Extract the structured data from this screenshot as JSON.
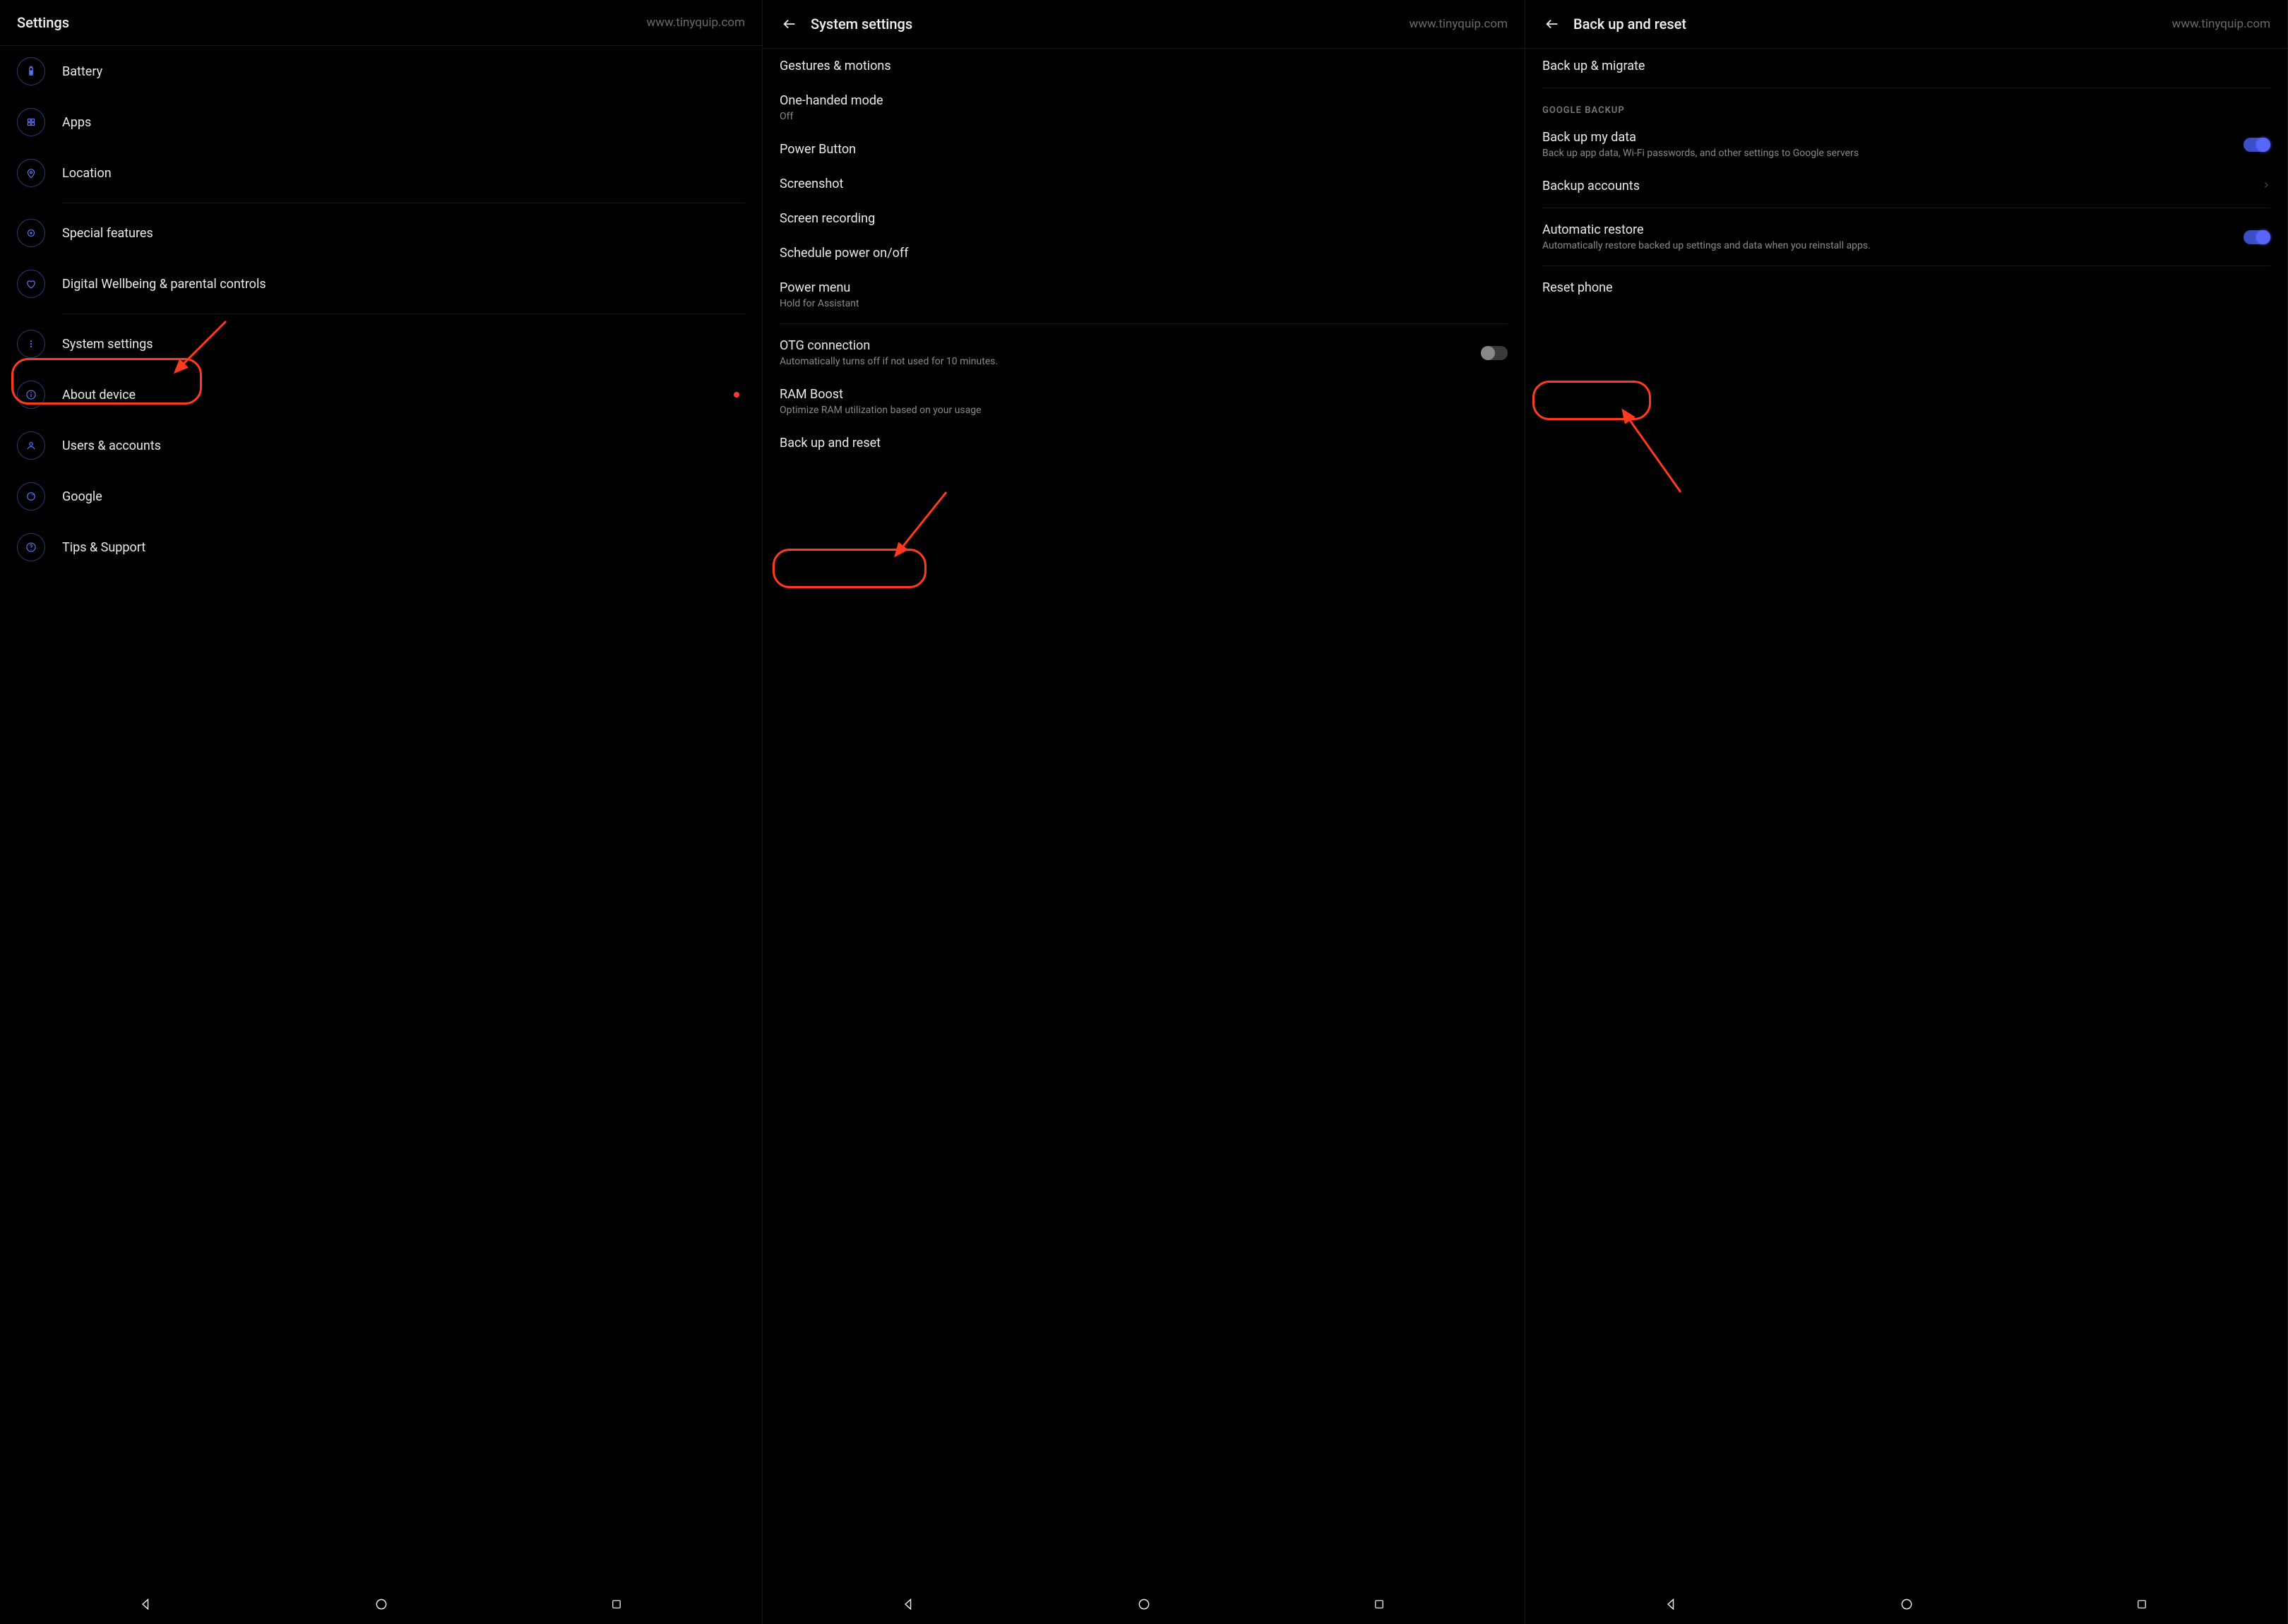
{
  "watermark": "www.tinyquip.com",
  "panel1": {
    "title": "Settings",
    "items": [
      {
        "label": "Battery",
        "icon": "battery"
      },
      {
        "label": "Apps",
        "icon": "grid"
      },
      {
        "label": "Location",
        "icon": "pin"
      },
      {
        "label": "Special features",
        "icon": "star"
      },
      {
        "label": "Digital Wellbeing & parental controls",
        "icon": "heart"
      },
      {
        "label": "System settings",
        "icon": "dots"
      },
      {
        "label": "About device",
        "icon": "info"
      },
      {
        "label": "Users & accounts",
        "icon": "user"
      },
      {
        "label": "Google",
        "icon": "google"
      },
      {
        "label": "Tips & Support",
        "icon": "help"
      }
    ]
  },
  "panel2": {
    "title": "System settings",
    "items": [
      {
        "label": "Gestures & motions"
      },
      {
        "label": "One-handed mode",
        "sub": "Off"
      },
      {
        "label": "Power Button"
      },
      {
        "label": "Screenshot"
      },
      {
        "label": "Screen recording"
      },
      {
        "label": "Schedule power on/off"
      },
      {
        "label": "Power menu",
        "sub": "Hold for Assistant"
      },
      {
        "label": "OTG connection",
        "sub": "Automatically turns off if not used for 10 minutes.",
        "toggle": "off"
      },
      {
        "label": "RAM Boost",
        "sub": "Optimize RAM utilization based on your usage"
      },
      {
        "label": "Back up and reset"
      }
    ]
  },
  "panel3": {
    "title": "Back up and reset",
    "section1": [
      {
        "label": "Back up & migrate"
      }
    ],
    "sectionTitle": "GOOGLE BACKUP",
    "section2": [
      {
        "label": "Back up my data",
        "sub": "Back up app data, Wi-Fi passwords, and other settings to Google servers",
        "toggle": "on"
      },
      {
        "label": "Backup accounts",
        "chevron": true
      },
      {
        "label": "Automatic restore",
        "sub": "Automatically restore backed up settings and data when you reinstall apps.",
        "toggle": "on"
      },
      {
        "label": "Reset phone"
      }
    ]
  }
}
